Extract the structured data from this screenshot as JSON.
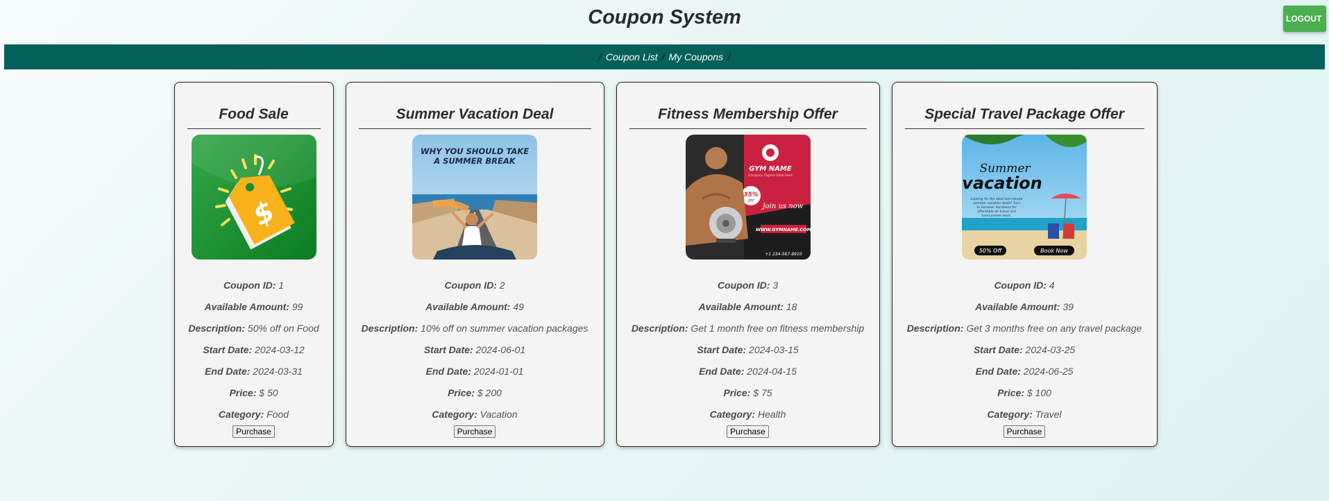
{
  "app": {
    "title": "Coupon System",
    "logout_label": "LOGOUT"
  },
  "nav": {
    "separator": "/",
    "links": [
      "Coupon List",
      "My Coupons"
    ]
  },
  "labels": {
    "coupon_id": "Coupon ID:",
    "available_amount": "Available Amount:",
    "description": "Description:",
    "start_date": "Start Date:",
    "end_date": "End Date:",
    "price": "Price:",
    "category": "Category:",
    "purchase": "Purchase"
  },
  "coupons": [
    {
      "title": "Food Sale",
      "image_icon": "price-tag-dollar-icon",
      "id": "1",
      "amount": "99",
      "description": "50% off on Food",
      "start": "2024-03-12",
      "end": "2024-03-31",
      "price": "$ 50",
      "category": "Food"
    },
    {
      "title": "Summer Vacation Deal",
      "image_icon": "summer-road-photo",
      "image_text": "WHY YOU SHOULD TAKE A SUMMER BREAK",
      "id": "2",
      "amount": "49",
      "description": "10% off on summer vacation packages",
      "start": "2024-06-01",
      "end": "2024-01-01",
      "price": "$ 200",
      "category": "Vacation"
    },
    {
      "title": "Fitness Membership Offer",
      "image_icon": "gym-flyer",
      "image_text": {
        "brand": "GYM NAME",
        "tagline": "Company Tagline Goes Here",
        "badge": "35%",
        "badge_sub": "OFF",
        "join": "Join us now",
        "url": "WWW.GYMNAME.COM",
        "phone": "+1 234-567-8910"
      },
      "id": "3",
      "amount": "18",
      "description": "Get 1 month free on fitness membership",
      "start": "2024-03-15",
      "end": "2024-04-15",
      "price": "$ 75",
      "category": "Health"
    },
    {
      "title": "Special Travel Package Offer",
      "image_icon": "beach-vacation-flyer",
      "image_text": {
        "script": "Summer",
        "big": "vacation",
        "body": "Looking for the ideal last-minute summer vacation deals? Turn to Summer Vacations for affordable air travel and hand-picked deals.",
        "discount": "50% Off",
        "cta": "Book Now"
      },
      "id": "4",
      "amount": "39",
      "description": "Get 3 months free on any travel package",
      "start": "2024-03-25",
      "end": "2024-06-25",
      "price": "$ 100",
      "category": "Travel"
    }
  ],
  "colors": {
    "nav": "#04605a",
    "logout": "#4caf50"
  }
}
